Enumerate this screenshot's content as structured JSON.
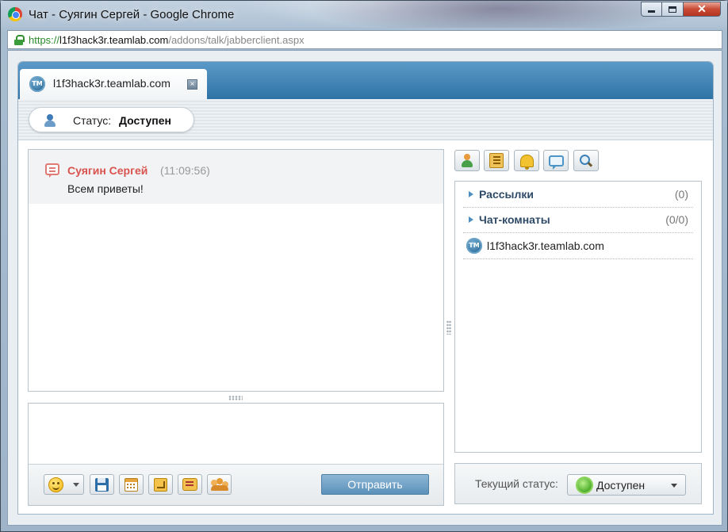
{
  "window": {
    "title": "Чат - Суягин Сергей - Google Chrome",
    "controls": {
      "minimize": "",
      "maximize": "",
      "close": "✕"
    }
  },
  "address": {
    "scheme": "https://",
    "host": "l1f3hack3r.teamlab.com",
    "path": "/addons/talk/jabberclient.aspx"
  },
  "tab": {
    "icon_text": "TM",
    "label": "l1f3hack3r.teamlab.com",
    "close": "×"
  },
  "status": {
    "label": "Статус:",
    "value": "Доступен"
  },
  "messages": [
    {
      "author": "Суягин Сергей",
      "time": "(11:09:56)",
      "text": "Всем приветы!"
    }
  ],
  "compose": {
    "send_label": "Отправить",
    "toolbar_icons": [
      "smile-icon",
      "save-icon",
      "calendar-icon",
      "enter-icon",
      "chat-history-icon",
      "group-icon"
    ]
  },
  "right_toolbar": {
    "icons": [
      "add-contact-icon",
      "address-book-icon",
      "bell-icon",
      "speech-icon",
      "search-icon"
    ]
  },
  "contacts": {
    "groups": [
      {
        "name": "Рассылки",
        "count": "(0)"
      },
      {
        "name": "Чат-комнаты",
        "count": "(0/0)"
      }
    ],
    "items": [
      {
        "name": "l1f3hack3r.teamlab.com",
        "icon_text": "TM"
      }
    ]
  },
  "current_status": {
    "label": "Текущий статус:",
    "value": "Доступен"
  },
  "colors": {
    "accent": "#2f73a6",
    "author": "#d9534f",
    "send_button": "#5c91ba",
    "online": "#4fae2a"
  }
}
